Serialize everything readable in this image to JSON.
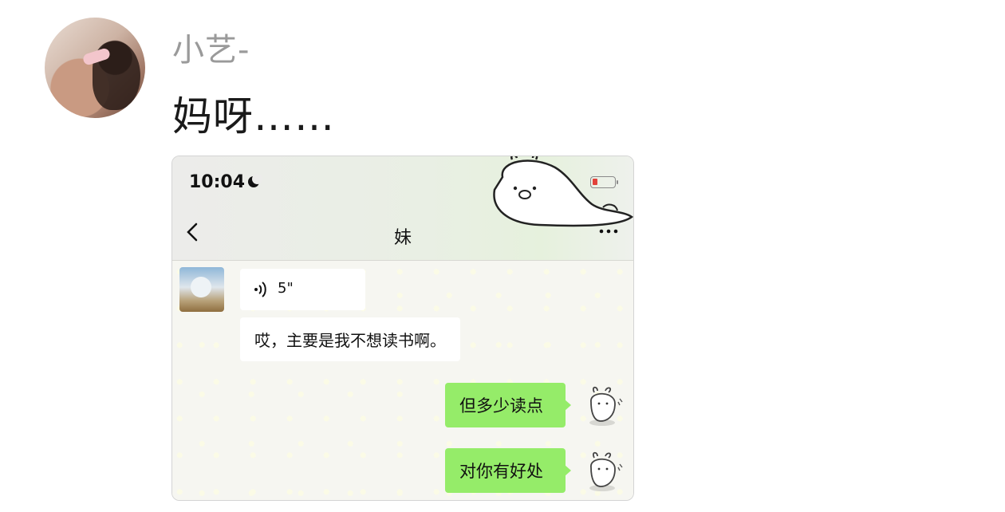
{
  "post": {
    "username": "小艺-",
    "text": "妈呀……"
  },
  "screenshot": {
    "status_time": "10:04",
    "chat_title": "妹",
    "messages": [
      {
        "from": "peer",
        "type": "voice",
        "duration": "5\""
      },
      {
        "from": "peer",
        "type": "text",
        "text": "哎，主要是我不想读书啊。"
      },
      {
        "from": "me",
        "type": "text",
        "text": "但多少读点"
      },
      {
        "from": "me",
        "type": "text",
        "text": "对你有好处"
      }
    ]
  },
  "colors": {
    "me_bubble": "#95ec69",
    "peer_bubble": "#ffffff",
    "battery_low": "#e2423a"
  },
  "icons": [
    "moon-icon",
    "battery-icon",
    "back-icon",
    "more-icon",
    "voice-icon"
  ]
}
